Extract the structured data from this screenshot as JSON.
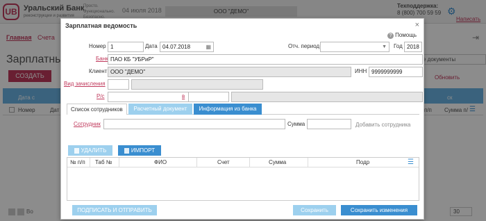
{
  "app": {
    "logo_text": "UB",
    "bank_name": "Уральский Банк",
    "bank_sub": "реконструкции и развития",
    "slogan": "Просто. Функционально. Безопасно.",
    "date": "04 июля 2018",
    "org": "ООО \"ДЕМО\"",
    "support_title": "Техподдержка:",
    "support_phone": "8 (800) 700 59 59",
    "write_link": "Написать",
    "nav": {
      "main": "Главная",
      "accounts": "Счета"
    },
    "page_title": "Зарплатные ведомости",
    "create_button": "СОЗДАТЬ",
    "docs_select": "е документы",
    "refresh": "Обновить",
    "filter_date": "Дата с",
    "filter_search": "ск",
    "table_head": {
      "num": "Номер",
      "date": "Дат",
      "pp": "п/п",
      "sum": "Сумма п/"
    },
    "pager_text": "Во",
    "per_page": "30"
  },
  "modal": {
    "title": "Зарплатная ведомость",
    "help": "Помощь",
    "labels": {
      "number": "Номер",
      "date": "Дата",
      "period": "Отч. период",
      "year": "Год",
      "bank": "Банк",
      "client": "Клиент",
      "inn": "ИНН",
      "transfer_type": "Вид зачисления",
      "account": "Р/с",
      "in": "в",
      "employee": "Сотрудник",
      "sum": "Сумма"
    },
    "values": {
      "number": "1",
      "date": "04.07.2018",
      "period": "",
      "year": "2018",
      "bank": "ПАО КБ \"УБРиР\"",
      "client": "ООО \"ДЕМО\"",
      "inn": "9999999999",
      "transfer_type": "",
      "account": "",
      "bank_place": "",
      "employee": "",
      "sum": ""
    },
    "tabs": [
      "Список сотрудников",
      "Расчетный документ",
      "Информация из банка"
    ],
    "add_employee": "Добавить сотрудника",
    "delete_button": "УДАЛИТЬ",
    "import_button": "ИМПОРТ",
    "grid_columns": [
      "№ п/п",
      "Таб №",
      "ФИО",
      "Счет",
      "Сумма",
      "Подр"
    ],
    "sign_button": "ПОДПИСАТЬ И ОТПРАВИТЬ",
    "save_button": "Сохранить",
    "save_changes_button": "Сохранить изменения"
  }
}
